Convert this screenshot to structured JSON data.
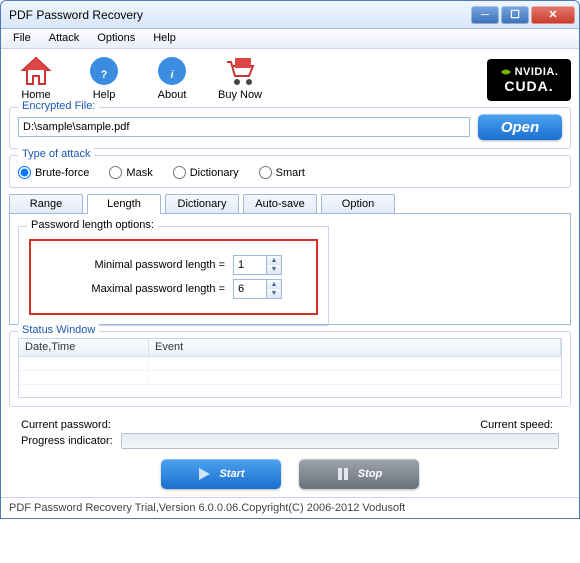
{
  "title": "PDF Password Recovery",
  "menu": [
    "File",
    "Attack",
    "Options",
    "Help"
  ],
  "toolbar": [
    {
      "label": "Home",
      "icon": "home-icon"
    },
    {
      "label": "Help",
      "icon": "help-icon"
    },
    {
      "label": "About",
      "icon": "about-icon"
    },
    {
      "label": "Buy Now",
      "icon": "buy-icon"
    }
  ],
  "cuda": {
    "line1": "NVIDIA.",
    "line2": "CUDA."
  },
  "fileGroup": {
    "legend": "Encrypted File:",
    "path": "D:\\sample\\sample.pdf",
    "openLabel": "Open"
  },
  "attackGroup": {
    "legend": "Type of attack",
    "options": [
      "Brute-force",
      "Mask",
      "Dictionary",
      "Smart"
    ],
    "selected": "Brute-force"
  },
  "tabs": [
    "Range",
    "Length",
    "Dictionary",
    "Auto-save",
    "Option"
  ],
  "activeTab": "Length",
  "lengthPane": {
    "legend": "Password length options:",
    "minLabel": "Minimal password length  =",
    "minValue": "1",
    "maxLabel": "Maximal password length  =",
    "maxValue": "6"
  },
  "statusGroup": {
    "legend": "Status Window",
    "columns": [
      "Date,Time",
      "Event"
    ]
  },
  "currentPasswordLabel": "Current password:",
  "currentSpeedLabel": "Current speed:",
  "progressLabel": "Progress indicator:",
  "startLabel": "Start",
  "stopLabel": "Stop",
  "footer": "PDF Password Recovery Trial,Version 6.0.0.06.Copyright(C) 2006-2012 Vodusoft"
}
